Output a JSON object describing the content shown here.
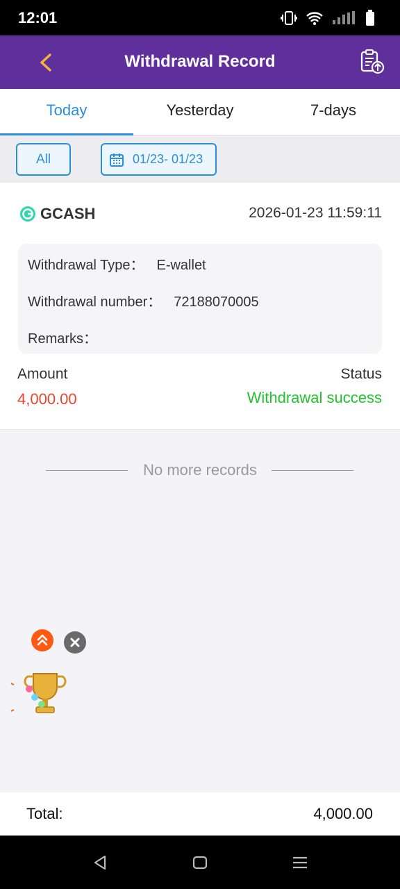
{
  "status_bar": {
    "time": "12:01"
  },
  "header": {
    "title": "Withdrawal Record",
    "back_icon": "back-arrow-icon",
    "action_icon": "clipboard-upload-icon",
    "color": "#5f2f9b"
  },
  "tabs": [
    {
      "label": "Today",
      "active": true
    },
    {
      "label": "Yesterday",
      "active": false
    },
    {
      "label": "7-days",
      "active": false
    }
  ],
  "filters": {
    "all_label": "All",
    "date_range": "01/23- 01/23"
  },
  "record": {
    "method": "GCASH",
    "datetime": "2026-01-23 11:59:11",
    "type_label": "Withdrawal Type：",
    "type_value": "E-wallet",
    "number_label": "Withdrawal number：",
    "number_value": "72188070005",
    "remarks_label": "Remarks：",
    "remarks_value": "",
    "amount_label": "Amount",
    "amount_value": "4,000.00",
    "status_label": "Status",
    "status_value": "Withdrawal success",
    "status_color": "#22c22e",
    "amount_color": "#e8452c"
  },
  "no_more": "No more records",
  "total": {
    "label": "Total:",
    "value": "4,000.00"
  }
}
